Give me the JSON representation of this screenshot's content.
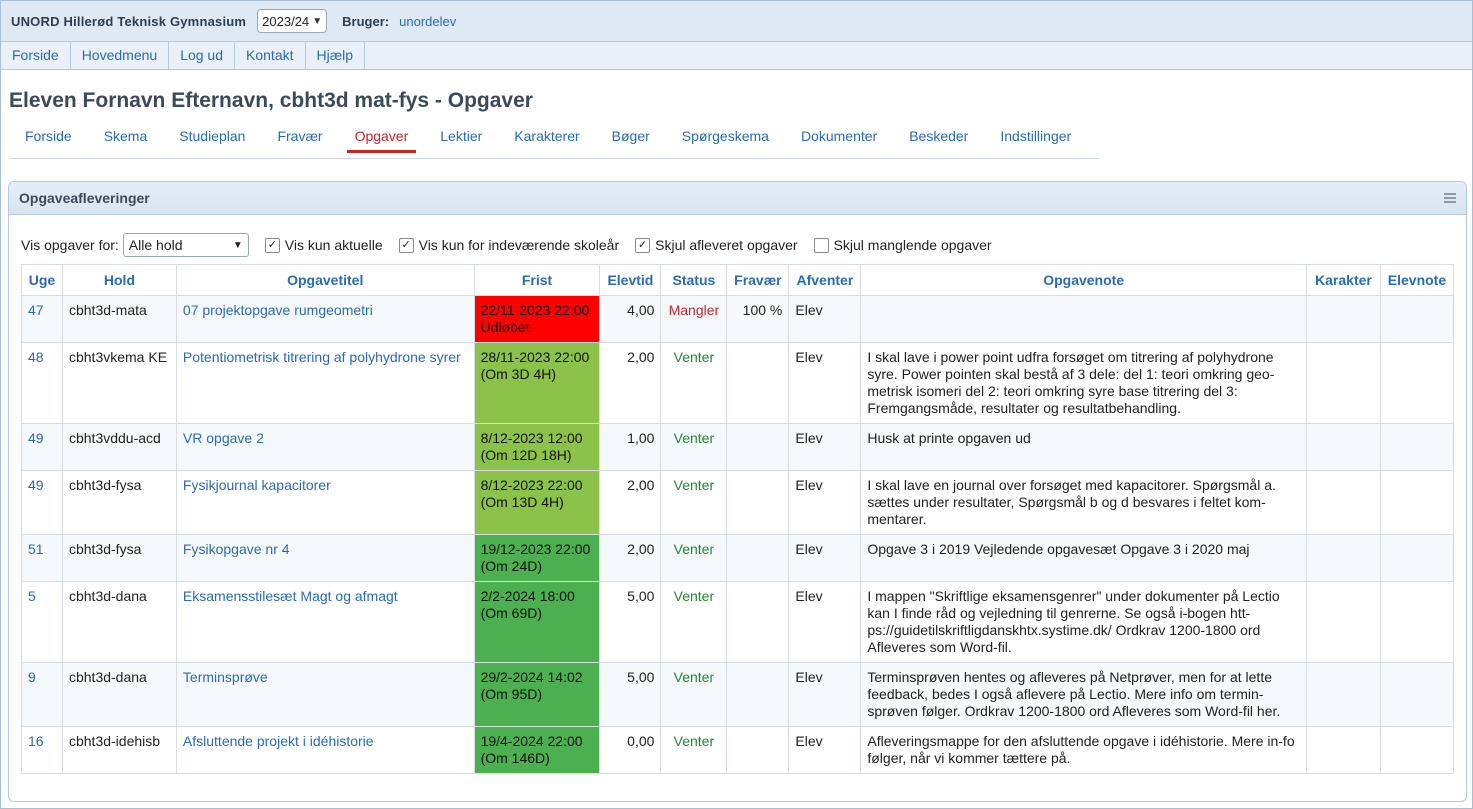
{
  "header": {
    "school": "UNORD Hillerød Teknisk Gymnasium",
    "year": "2023/24",
    "user_label": "Bruger:",
    "user_name": "unordelev"
  },
  "menu": [
    "Forside",
    "Hovedmenu",
    "Log ud",
    "Kontakt",
    "Hjælp"
  ],
  "page_title": "Eleven Fornavn Efternavn, cbht3d mat-fys - Opgaver",
  "tabs": [
    {
      "label": "Forside",
      "active": false
    },
    {
      "label": "Skema",
      "active": false
    },
    {
      "label": "Studieplan",
      "active": false
    },
    {
      "label": "Fravær",
      "active": false
    },
    {
      "label": "Opgaver",
      "active": true
    },
    {
      "label": "Lektier",
      "active": false
    },
    {
      "label": "Karakterer",
      "active": false
    },
    {
      "label": "Bøger",
      "active": false
    },
    {
      "label": "Spørgeskema",
      "active": false
    },
    {
      "label": "Dokumenter",
      "active": false
    },
    {
      "label": "Beskeder",
      "active": false
    },
    {
      "label": "Indstillinger",
      "active": false
    }
  ],
  "panel": {
    "title": "Opgaveafleveringer",
    "menu_icon": "hamburger-icon"
  },
  "filters": {
    "label": "Vis opgaver for:",
    "select_value": "Alle hold",
    "checkboxes": [
      {
        "label": "Vis kun aktuelle",
        "checked": true
      },
      {
        "label": "Vis kun for indeværende skoleår",
        "checked": true
      },
      {
        "label": "Skjul afleveret opgaver",
        "checked": true
      },
      {
        "label": "Skjul manglende opgaver",
        "checked": false
      }
    ]
  },
  "table": {
    "headers": [
      "Uge",
      "Hold",
      "Opgavetitel",
      "Frist",
      "Elevtid",
      "Status",
      "Fravær",
      "Afventer",
      "Opgavenote",
      "Karakter",
      "Elevnote"
    ],
    "rows": [
      {
        "uge": "47",
        "hold": "cbht3d-mata",
        "titel": "07 projektopgave rumgeometri",
        "frist1": "22/11-2023 22:00",
        "frist2": "Udløbet",
        "frist_color": "#ff0000",
        "elevtid": "4,00",
        "status": "Mangler",
        "fravaer": "100 %",
        "afventer": "Elev",
        "note": "",
        "karakter": "",
        "elevnote": ""
      },
      {
        "uge": "48",
        "hold": "cbht3vkema KE",
        "titel": "Potentiometrisk titrering af polyhydrone syrer",
        "frist1": "28/11-2023 22:00",
        "frist2": "(Om 3D 4H)",
        "frist_color": "#8bc34a",
        "elevtid": "2,00",
        "status": "Venter",
        "fravaer": "",
        "afventer": "Elev",
        "note": "I skal lave i power point udfra forsøget om titrering af polyhydrone syre. Power pointen skal bestå af 3 dele: del 1: teori omkring geo-metrisk isomeri del 2: teori omkring syre base titrering del 3: Fremgangsmåde, resultater og resultatbehandling.",
        "karakter": "",
        "elevnote": ""
      },
      {
        "uge": "49",
        "hold": "cbht3vddu-acd",
        "titel": "VR opgave 2",
        "frist1": "8/12-2023 12:00",
        "frist2": "(Om 12D 18H)",
        "frist_color": "#8bc34a",
        "elevtid": "1,00",
        "status": "Venter",
        "fravaer": "",
        "afventer": "Elev",
        "note": "Husk at printe opgaven ud",
        "karakter": "",
        "elevnote": ""
      },
      {
        "uge": "49",
        "hold": "cbht3d-fysa",
        "titel": "Fysikjournal kapacitorer",
        "frist1": "8/12-2023 22:00",
        "frist2": "(Om 13D 4H)",
        "frist_color": "#8bc34a",
        "elevtid": "2,00",
        "status": "Venter",
        "fravaer": "",
        "afventer": "Elev",
        "note": "I skal lave en journal over forsøget med kapacitorer. Spørgsmål a. sættes under resultater, Spørgsmål b og d besvares i feltet kom-mentarer.",
        "karakter": "",
        "elevnote": ""
      },
      {
        "uge": "51",
        "hold": "cbht3d-fysa",
        "titel": "Fysikopgave nr 4",
        "frist1": "19/12-2023 22:00",
        "frist2": "(Om 24D)",
        "frist_color": "#4caf50",
        "elevtid": "2,00",
        "status": "Venter",
        "fravaer": "",
        "afventer": "Elev",
        "note": "Opgave 3 i 2019 Vejledende opgavesæt Opgave 3 i 2020 maj",
        "karakter": "",
        "elevnote": ""
      },
      {
        "uge": "5",
        "hold": "cbht3d-dana",
        "titel": "Eksamensstilesæt Magt og afmagt",
        "frist1": "2/2-2024 18:00",
        "frist2": "(Om 69D)",
        "frist_color": "#4caf50",
        "elevtid": "5,00",
        "status": "Venter",
        "fravaer": "",
        "afventer": "Elev",
        "note": "I mappen \"Skriftlige eksamensgenrer\" under dokumenter på Lectio kan I finde råd og vejledning til genrerne. Se også i-bogen htt-ps://guidetilskriftligdanskhtx.systime.dk/ Ordkrav 1200-1800 ord Afleveres som Word-fil.",
        "karakter": "",
        "elevnote": ""
      },
      {
        "uge": "9",
        "hold": "cbht3d-dana",
        "titel": "Terminsprøve",
        "frist1": "29/2-2024 14:02",
        "frist2": "(Om 95D)",
        "frist_color": "#4caf50",
        "elevtid": "5,00",
        "status": "Venter",
        "fravaer": "",
        "afventer": "Elev",
        "note": "Terminsprøven hentes og afleveres på Netprøver, men for at lette feedback, bedes I også aflevere på Lectio. Mere info om termin-sprøven følger. Ordkrav 1200-1800 ord Afleveres som Word-fil her.",
        "karakter": "",
        "elevnote": ""
      },
      {
        "uge": "16",
        "hold": "cbht3d-idehisb",
        "titel": "Afsluttende projekt i idéhistorie",
        "frist1": "19/4-2024 22:00",
        "frist2": "(Om 146D)",
        "frist_color": "#4caf50",
        "elevtid": "0,00",
        "status": "Venter",
        "fravaer": "",
        "afventer": "Elev",
        "note": "Afleveringsmappe for den afsluttende opgave i idéhistorie. Mere in-fo følger, når vi kommer tættere på.",
        "karakter": "",
        "elevnote": ""
      }
    ]
  },
  "colors": {
    "link": "#2a6cb0",
    "active_tab": "#c0272d",
    "status_venter": "#1e8a2f",
    "status_mangler": "#c0272d"
  }
}
